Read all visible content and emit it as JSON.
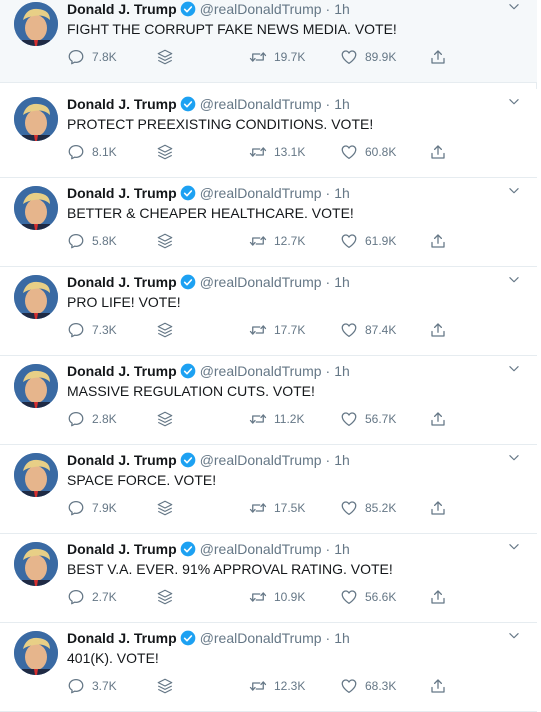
{
  "author": {
    "name": "Donald J. Trump",
    "handle": "@realDonaldTrump",
    "separator": "·",
    "time": "1h"
  },
  "colors": {
    "text": "#14171a",
    "muted": "#657786",
    "border": "#e6ecf0",
    "verified": "#1da1f2",
    "hover_bg": "#f5f8fa"
  },
  "icons": {
    "reply": "reply-icon",
    "layers": "layers-icon",
    "retweet": "retweet-icon",
    "like": "heart-icon",
    "share": "share-icon",
    "verified": "verified-badge-icon",
    "caret": "chevron-down-icon"
  },
  "tweets": [
    {
      "text": "FIGHT THE CORRUPT FAKE NEWS MEDIA. VOTE!",
      "replies": "7.8K",
      "retweets": "19.7K",
      "likes": "89.9K"
    },
    {
      "text": "PROTECT PREEXISTING CONDITIONS. VOTE!",
      "replies": "8.1K",
      "retweets": "13.1K",
      "likes": "60.8K"
    },
    {
      "text": "BETTER & CHEAPER HEALTHCARE. VOTE!",
      "replies": "5.8K",
      "retweets": "12.7K",
      "likes": "61.9K"
    },
    {
      "text": "PRO LIFE! VOTE!",
      "replies": "7.3K",
      "retweets": "17.7K",
      "likes": "87.4K"
    },
    {
      "text": "MASSIVE REGULATION CUTS. VOTE!",
      "replies": "2.8K",
      "retweets": "11.2K",
      "likes": "56.7K"
    },
    {
      "text": "SPACE FORCE. VOTE!",
      "replies": "7.9K",
      "retweets": "17.5K",
      "likes": "85.2K"
    },
    {
      "text": "BEST V.A. EVER. 91% APPROVAL RATING. VOTE!",
      "replies": "2.7K",
      "retweets": "10.9K",
      "likes": "56.6K"
    },
    {
      "text": "401(K). VOTE!",
      "replies": "3.7K",
      "retweets": "12.3K",
      "likes": "68.3K"
    }
  ]
}
